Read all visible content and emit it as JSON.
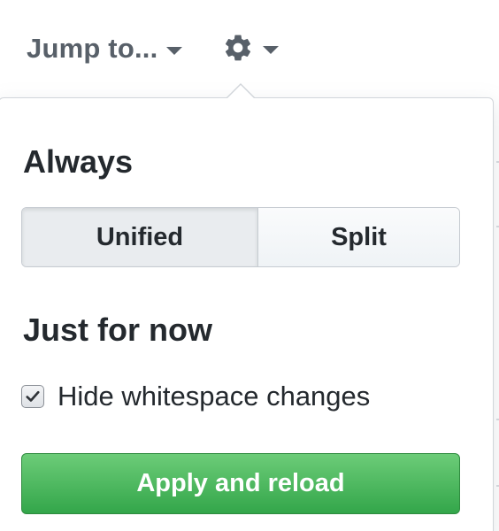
{
  "toolbar": {
    "jump_to_label": "Jump to...",
    "jump_caret_icon": "caret-down-icon",
    "settings_icon": "gear-icon",
    "settings_caret_icon": "caret-down-icon"
  },
  "popover": {
    "always_title": "Always",
    "view_options": [
      {
        "label": "Unified",
        "selected": true
      },
      {
        "label": "Split",
        "selected": false
      }
    ],
    "just_for_now_title": "Just for now",
    "hide_whitespace": {
      "label": "Hide whitespace changes",
      "checked": true
    },
    "apply_button_label": "Apply and reload"
  },
  "colors": {
    "text_primary": "#24292e",
    "text_muted": "#586069",
    "apply_green": "#33a64a",
    "selected_segment_bg": "#e9ecef"
  }
}
